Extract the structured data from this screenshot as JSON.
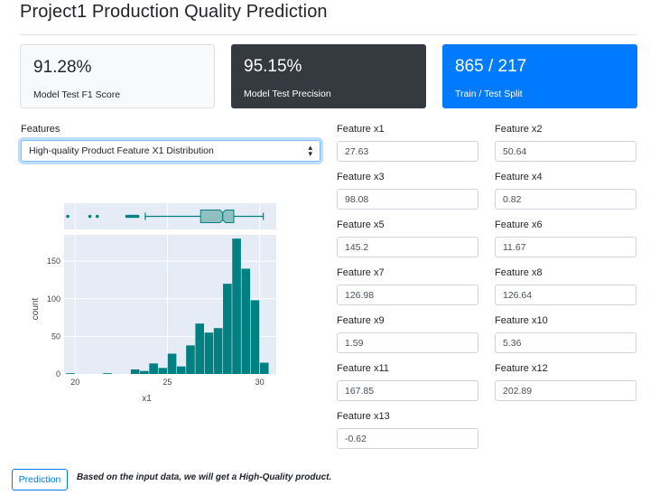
{
  "page": {
    "title": "Project1 Production Quality Prediction"
  },
  "cards": [
    {
      "value": "91.28%",
      "label": "Model Test F1 Score"
    },
    {
      "value": "95.15%",
      "label": "Model Test Precision"
    },
    {
      "value": "865 / 217",
      "label": "Train / Test Split"
    }
  ],
  "features_dropdown": {
    "label": "Features",
    "selected": "High-quality Product Feature X1 Distribution"
  },
  "feature_inputs": [
    {
      "label": "Feature x1",
      "value": "27.63"
    },
    {
      "label": "Feature x2",
      "value": "50.64"
    },
    {
      "label": "Feature x3",
      "value": "98.08"
    },
    {
      "label": "Feature x4",
      "value": "0.82"
    },
    {
      "label": "Feature x5",
      "value": "145.2"
    },
    {
      "label": "Feature x6",
      "value": "11.67"
    },
    {
      "label": "Feature x7",
      "value": "126.98"
    },
    {
      "label": "Feature x8",
      "value": "126.64"
    },
    {
      "label": "Feature x9",
      "value": "1.59"
    },
    {
      "label": "Feature x10",
      "value": "5.36"
    },
    {
      "label": "Feature x11",
      "value": "167.85"
    },
    {
      "label": "Feature x12",
      "value": "202.89"
    },
    {
      "label": "Feature x13",
      "value": "-0.62"
    }
  ],
  "actions": {
    "predict_label": "Prediction"
  },
  "result": {
    "text": "Based on the input data, we will get a High-Quality product."
  },
  "chart_data": {
    "type": "bar",
    "xlabel": "x1",
    "ylabel": "count",
    "xlim": [
      19.4,
      30.9
    ],
    "ylim": [
      0,
      185
    ],
    "xticks": [
      "20",
      "25",
      "30"
    ],
    "yticks": [
      "0",
      "50",
      "100",
      "150"
    ],
    "bin_width": 0.5,
    "bins": [
      19.5,
      20.0,
      20.5,
      21.0,
      21.5,
      22.0,
      22.5,
      23.0,
      23.5,
      24.0,
      24.5,
      25.0,
      25.5,
      26.0,
      26.5,
      27.0,
      27.5,
      28.0,
      28.5,
      29.0,
      29.5,
      30.0
    ],
    "values": [
      1,
      0,
      0,
      0,
      1,
      0,
      0,
      6,
      4,
      14,
      8,
      27,
      10,
      38,
      67,
      55,
      61,
      120,
      180,
      140,
      98,
      15
    ],
    "box": {
      "min": 23.8,
      "q1": 26.8,
      "median": 28.0,
      "q3": 28.6,
      "max": 30.2,
      "outliers": [
        19.6,
        20.8,
        21.2,
        22.8,
        22.9,
        23.0,
        23.1,
        23.2,
        23.3,
        23.4
      ]
    },
    "bar_color": "#008080",
    "plot_bg": "#e5ecf6",
    "box_color": "#8fbfbf"
  }
}
